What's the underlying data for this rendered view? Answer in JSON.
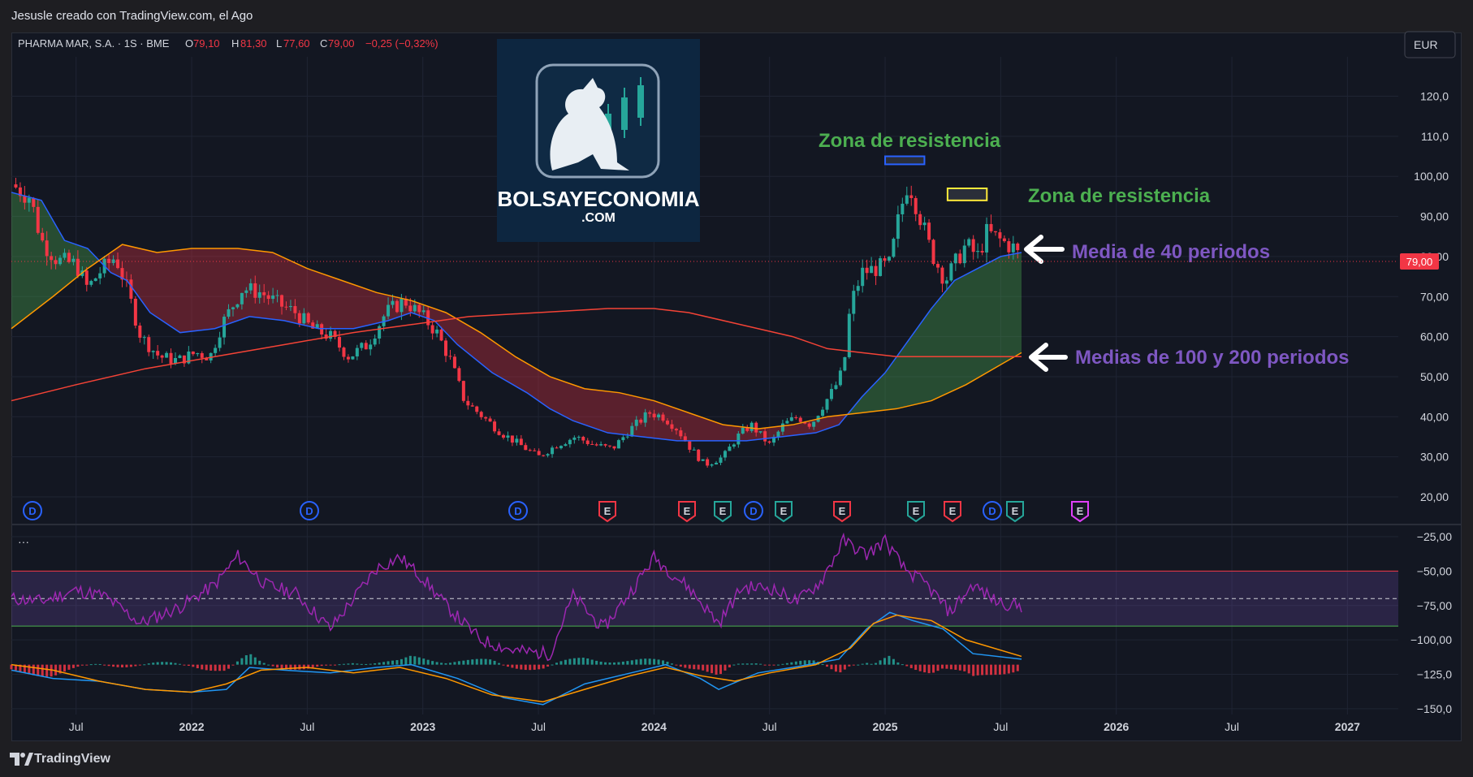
{
  "header": {
    "attribution": "Jesusle creado con TradingView.com, el Ago"
  },
  "legend": {
    "symbol": "PHARMA MAR, S.A. · 1S · BME",
    "o_label": "O",
    "o_value": "79,10",
    "h_label": "H",
    "h_value": "81,30",
    "l_label": "L",
    "l_value": "77,60",
    "c_label": "C",
    "c_value": "79,00",
    "change": "−0,25 (−0,32%)"
  },
  "currency": "EUR",
  "price_label": "79,00",
  "logo": {
    "line1": "BOLSAYECONOMIA",
    "line2": ".COM"
  },
  "annotations": {
    "resistance1": "Zona de resistencia",
    "resistance2": "Zona de resistencia",
    "ma40": "Media de 40 periodos",
    "ma100_200": "Medias de 100 y 200 periodos"
  },
  "event_markers": [
    "D",
    "D",
    "D",
    "E",
    "E",
    "E",
    "D",
    "E",
    "E",
    "E",
    "E",
    "D",
    "E",
    "E"
  ],
  "indicator_menu": "···",
  "footer": {
    "brand": "TradingView"
  },
  "colors": {
    "up": "#26a69a",
    "down": "#f23645",
    "ma40": "#2962ff",
    "ma100": "#ff9800",
    "ma200": "#f44336",
    "rsi": "#9c27b0",
    "annotation_green": "#4caf50",
    "annotation_purple": "#7e57c2"
  },
  "chart_data": [
    {
      "type": "candlestick",
      "title": "PHARMA MAR, S.A. · 1S · BME",
      "y_unit": "EUR",
      "ylim": [
        15,
        130
      ],
      "y_ticks": [
        "120,0",
        "110,0",
        "100,00",
        "90,00",
        "80,00",
        "70,00",
        "60,00",
        "50,00",
        "40,00",
        "30,00",
        "20,00"
      ],
      "x_ticks": [
        "Jul",
        "2022",
        "Jul",
        "2023",
        "Jul",
        "2024",
        "Jul",
        "2025",
        "Jul",
        "2026",
        "Jul",
        "2027"
      ],
      "x_tick_times": [
        2021.5,
        2022.0,
        2022.5,
        2023.0,
        2023.5,
        2024.0,
        2024.5,
        2025.0,
        2025.5,
        2026.0,
        2026.5,
        2027.0
      ],
      "xlim": [
        2021.22,
        2027.22
      ],
      "close_path": [
        [
          2021.22,
          98
        ],
        [
          2021.3,
          95
        ],
        [
          2021.35,
          84
        ],
        [
          2021.42,
          79
        ],
        [
          2021.5,
          78
        ],
        [
          2021.55,
          72
        ],
        [
          2021.6,
          76
        ],
        [
          2021.67,
          80
        ],
        [
          2021.72,
          72
        ],
        [
          2021.78,
          60
        ],
        [
          2021.86,
          55
        ],
        [
          2021.94,
          54
        ],
        [
          2022.02,
          56
        ],
        [
          2022.08,
          55
        ],
        [
          2022.13,
          63
        ],
        [
          2022.22,
          72
        ],
        [
          2022.3,
          71
        ],
        [
          2022.38,
          68
        ],
        [
          2022.45,
          66
        ],
        [
          2022.52,
          62
        ],
        [
          2022.6,
          60
        ],
        [
          2022.68,
          55
        ],
        [
          2022.76,
          58
        ],
        [
          2022.84,
          66
        ],
        [
          2022.92,
          69
        ],
        [
          2023.0,
          65
        ],
        [
          2023.06,
          61
        ],
        [
          2023.12,
          54
        ],
        [
          2023.18,
          44
        ],
        [
          2023.26,
          40
        ],
        [
          2023.34,
          36
        ],
        [
          2023.42,
          33
        ],
        [
          2023.5,
          30
        ],
        [
          2023.58,
          33
        ],
        [
          2023.66,
          35
        ],
        [
          2023.74,
          33
        ],
        [
          2023.82,
          32
        ],
        [
          2023.9,
          37
        ],
        [
          2023.98,
          41
        ],
        [
          2024.04,
          40
        ],
        [
          2024.1,
          37
        ],
        [
          2024.16,
          32
        ],
        [
          2024.22,
          28
        ],
        [
          2024.3,
          30
        ],
        [
          2024.36,
          35
        ],
        [
          2024.42,
          38
        ],
        [
          2024.5,
          33
        ],
        [
          2024.56,
          38
        ],
        [
          2024.62,
          40
        ],
        [
          2024.68,
          38
        ],
        [
          2024.72,
          42
        ],
        [
          2024.78,
          47
        ],
        [
          2024.82,
          52
        ],
        [
          2024.85,
          68
        ],
        [
          2024.9,
          76
        ],
        [
          2024.96,
          77
        ],
        [
          2025.02,
          78
        ],
        [
          2025.06,
          90
        ],
        [
          2025.1,
          99
        ],
        [
          2025.14,
          92
        ],
        [
          2025.2,
          81
        ],
        [
          2025.26,
          74
        ],
        [
          2025.3,
          78
        ],
        [
          2025.35,
          83
        ],
        [
          2025.4,
          80
        ],
        [
          2025.44,
          86
        ],
        [
          2025.5,
          84
        ],
        [
          2025.56,
          82
        ],
        [
          2025.59,
          79
        ]
      ],
      "moving_averages": [
        {
          "name": "Media de 40 periodos",
          "color": "#2962ff",
          "points": [
            [
              2021.22,
              96
            ],
            [
              2021.35,
              94
            ],
            [
              2021.45,
              84
            ],
            [
              2021.55,
              82
            ],
            [
              2021.65,
              76
            ],
            [
              2021.72,
              74
            ],
            [
              2021.82,
              66
            ],
            [
              2021.95,
              61
            ],
            [
              2022.1,
              62
            ],
            [
              2022.25,
              65
            ],
            [
              2022.4,
              64
            ],
            [
              2022.55,
              62
            ],
            [
              2022.7,
              62
            ],
            [
              2022.85,
              64
            ],
            [
              2022.95,
              66
            ],
            [
              2023.05,
              64
            ],
            [
              2023.15,
              58
            ],
            [
              2023.3,
              51
            ],
            [
              2023.45,
              46
            ],
            [
              2023.55,
              42
            ],
            [
              2023.65,
              39
            ],
            [
              2023.8,
              36
            ],
            [
              2023.95,
              35
            ],
            [
              2024.1,
              34
            ],
            [
              2024.25,
              34
            ],
            [
              2024.4,
              34
            ],
            [
              2024.55,
              35
            ],
            [
              2024.7,
              36
            ],
            [
              2024.8,
              38
            ],
            [
              2024.9,
              45
            ],
            [
              2025.0,
              51
            ],
            [
              2025.1,
              59
            ],
            [
              2025.2,
              67
            ],
            [
              2025.3,
              74
            ],
            [
              2025.4,
              77
            ],
            [
              2025.5,
              80
            ],
            [
              2025.59,
              81
            ]
          ]
        },
        {
          "name": "Media de 100 periodos",
          "color": "#ff9800",
          "points": [
            [
              2021.22,
              62
            ],
            [
              2021.4,
              70
            ],
            [
              2021.55,
              77
            ],
            [
              2021.7,
              83
            ],
            [
              2021.85,
              81
            ],
            [
              2022.0,
              82
            ],
            [
              2022.2,
              82
            ],
            [
              2022.35,
              81
            ],
            [
              2022.5,
              77
            ],
            [
              2022.65,
              74
            ],
            [
              2022.8,
              71
            ],
            [
              2022.95,
              69
            ],
            [
              2023.1,
              66
            ],
            [
              2023.25,
              61
            ],
            [
              2023.4,
              55
            ],
            [
              2023.55,
              50
            ],
            [
              2023.7,
              47
            ],
            [
              2023.85,
              46
            ],
            [
              2024.0,
              44
            ],
            [
              2024.15,
              41
            ],
            [
              2024.3,
              38
            ],
            [
              2024.45,
              37
            ],
            [
              2024.6,
              38
            ],
            [
              2024.75,
              40
            ],
            [
              2024.9,
              41
            ],
            [
              2025.05,
              42
            ],
            [
              2025.2,
              44
            ],
            [
              2025.35,
              48
            ],
            [
              2025.5,
              53
            ],
            [
              2025.59,
              56
            ]
          ]
        },
        {
          "name": "Media de 200 periodos",
          "color": "#f44336",
          "points": [
            [
              2021.22,
              44
            ],
            [
              2021.5,
              48
            ],
            [
              2021.8,
              52
            ],
            [
              2022.1,
              55
            ],
            [
              2022.4,
              58
            ],
            [
              2022.7,
              61
            ],
            [
              2022.95,
              63
            ],
            [
              2023.2,
              65
            ],
            [
              2023.5,
              66
            ],
            [
              2023.8,
              67
            ],
            [
              2024.0,
              67
            ],
            [
              2024.15,
              66
            ],
            [
              2024.3,
              64
            ],
            [
              2024.45,
              62
            ],
            [
              2024.6,
              60
            ],
            [
              2024.75,
              57
            ],
            [
              2024.9,
              56
            ],
            [
              2025.05,
              55
            ],
            [
              2025.3,
              55
            ],
            [
              2025.59,
              55
            ]
          ]
        }
      ],
      "resistance_zones": [
        {
          "label": "Zona de resistencia",
          "y": [
            103,
            105
          ],
          "x": [
            2025.0,
            2025.17
          ]
        },
        {
          "label": "Zona de resistencia",
          "y": [
            94,
            97
          ],
          "x": [
            2025.27,
            2025.44
          ]
        }
      ],
      "last_price": 79.0
    },
    {
      "type": "line",
      "title": "",
      "y_ticks": [
        "−25,00",
        "−50,00",
        "−75,00",
        "−100,00",
        "−125,0",
        "−150,0"
      ],
      "ylim": [
        -160,
        -20
      ],
      "bands": [
        -50,
        -90
      ],
      "midline": -70,
      "series": [
        {
          "name": "",
          "color": "#9c27b0",
          "points": [
            [
              2021.22,
              -70
            ],
            [
              2021.35,
              -72
            ],
            [
              2021.5,
              -64
            ],
            [
              2021.62,
              -68
            ],
            [
              2021.78,
              -88
            ],
            [
              2021.95,
              -76
            ],
            [
              2022.1,
              -60
            ],
            [
              2022.2,
              -39
            ],
            [
              2022.32,
              -60
            ],
            [
              2022.45,
              -66
            ],
            [
              2022.6,
              -92
            ],
            [
              2022.8,
              -48
            ],
            [
              2022.9,
              -40
            ],
            [
              2023.0,
              -55
            ],
            [
              2023.1,
              -75
            ],
            [
              2023.25,
              -100
            ],
            [
              2023.4,
              -108
            ],
            [
              2023.55,
              -110
            ],
            [
              2023.65,
              -68
            ],
            [
              2023.78,
              -92
            ],
            [
              2023.92,
              -60
            ],
            [
              2024.0,
              -40
            ],
            [
              2024.15,
              -62
            ],
            [
              2024.28,
              -88
            ],
            [
              2024.38,
              -62
            ],
            [
              2024.5,
              -62
            ],
            [
              2024.62,
              -72
            ],
            [
              2024.72,
              -58
            ],
            [
              2024.82,
              -28
            ],
            [
              2024.92,
              -38
            ],
            [
              2025.0,
              -28
            ],
            [
              2025.08,
              -48
            ],
            [
              2025.18,
              -60
            ],
            [
              2025.28,
              -80
            ],
            [
              2025.38,
              -60
            ],
            [
              2025.48,
              -72
            ],
            [
              2025.59,
              -76
            ]
          ]
        }
      ]
    },
    {
      "type": "bar",
      "title": "",
      "series": [
        {
          "name": "",
          "color": "#2196f3",
          "points": [
            [
              2021.22,
              -122
            ],
            [
              2021.4,
              -128
            ],
            [
              2021.6,
              -130
            ],
            [
              2021.8,
              -136
            ],
            [
              2022.0,
              -138
            ],
            [
              2022.15,
              -136
            ],
            [
              2022.25,
              -120
            ],
            [
              2022.4,
              -122
            ],
            [
              2022.6,
              -124
            ],
            [
              2022.8,
              -120
            ],
            [
              2022.95,
              -118
            ],
            [
              2023.15,
              -128
            ],
            [
              2023.35,
              -142
            ],
            [
              2023.52,
              -147
            ],
            [
              2023.7,
              -132
            ],
            [
              2023.9,
              -124
            ],
            [
              2024.05,
              -118
            ],
            [
              2024.2,
              -128
            ],
            [
              2024.28,
              -136
            ],
            [
              2024.45,
              -124
            ],
            [
              2024.6,
              -120
            ],
            [
              2024.8,
              -114
            ],
            [
              2024.92,
              -92
            ],
            [
              2025.02,
              -80
            ],
            [
              2025.12,
              -86
            ],
            [
              2025.25,
              -92
            ],
            [
              2025.38,
              -110
            ],
            [
              2025.59,
              -114
            ]
          ]
        },
        {
          "name": "",
          "color": "#ff9800",
          "points": [
            [
              2021.22,
              -118
            ],
            [
              2021.4,
              -122
            ],
            [
              2021.6,
              -130
            ],
            [
              2021.8,
              -136
            ],
            [
              2022.0,
              -138
            ],
            [
              2022.15,
              -132
            ],
            [
              2022.3,
              -122
            ],
            [
              2022.5,
              -120
            ],
            [
              2022.7,
              -124
            ],
            [
              2022.9,
              -120
            ],
            [
              2023.1,
              -128
            ],
            [
              2023.3,
              -140
            ],
            [
              2023.52,
              -145
            ],
            [
              2023.7,
              -136
            ],
            [
              2023.9,
              -126
            ],
            [
              2024.05,
              -120
            ],
            [
              2024.2,
              -126
            ],
            [
              2024.35,
              -130
            ],
            [
              2024.5,
              -124
            ],
            [
              2024.7,
              -118
            ],
            [
              2024.85,
              -106
            ],
            [
              2024.95,
              -88
            ],
            [
              2025.05,
              -82
            ],
            [
              2025.2,
              -86
            ],
            [
              2025.35,
              -100
            ],
            [
              2025.59,
              -112
            ]
          ]
        }
      ]
    }
  ]
}
